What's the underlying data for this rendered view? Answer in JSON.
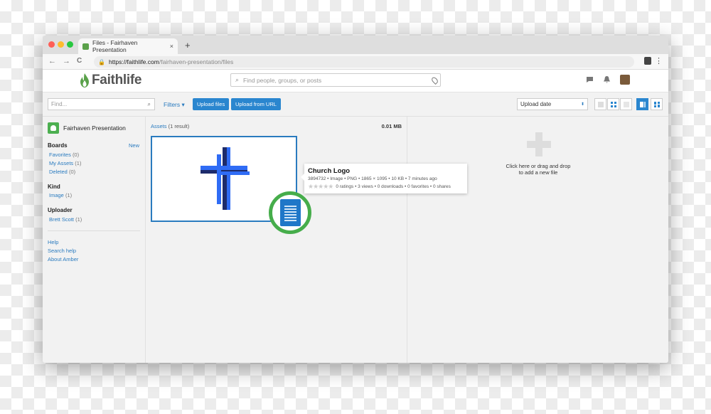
{
  "browser": {
    "tab_title": "Files - Fairhaven Presentation",
    "tab_close": "×",
    "new_tab": "+",
    "url_host": "https://faithlife.com",
    "url_path": "/fairhaven-presentation/files",
    "back": "←",
    "forward": "→",
    "reload": "C",
    "menu": "⋮",
    "dot_colors": [
      "#fe5f57",
      "#febc2e",
      "#28c840"
    ]
  },
  "header": {
    "logo_text": "Faithlife",
    "search_placeholder": "Find people, groups, or posts",
    "search_icon": "🔍",
    "chat_icon": "💬",
    "bell_icon": "🔔",
    "brand_color": "#5aa14a"
  },
  "toolbar": {
    "find_placeholder": "Find...",
    "filters_label": "Filters ▾",
    "upload_files_label": "Upload files",
    "upload_url_label": "Upload from URL",
    "sort_value": "Upload date",
    "sort_caret": "⬍",
    "accent": "#2a86cf"
  },
  "sidebar": {
    "group_name": "Fairhaven Presentation",
    "boards_heading": "Boards",
    "new_label": "New",
    "boards": [
      {
        "label": "Favorites",
        "count": "(0)"
      },
      {
        "label": "My Assets",
        "count": "(1)"
      },
      {
        "label": "Deleted",
        "count": "(0)"
      }
    ],
    "kind_heading": "Kind",
    "kinds": [
      {
        "label": "Image",
        "count": "(1)"
      }
    ],
    "uploader_heading": "Uploader",
    "uploaders": [
      {
        "label": "Brett Scott",
        "count": "(1)"
      }
    ],
    "links": [
      "Help",
      "Search help",
      "About Amber"
    ]
  },
  "assets": {
    "assets_label": "Assets",
    "result_count": "(1 result)",
    "total_size": "0.01 MB"
  },
  "tooltip": {
    "title": "Church Logo",
    "meta": "3894732  •  Image  •  PNG  •  1865 × 1095  •  10 KB  •  7 minutes ago",
    "stars": "★★★★★",
    "stats": "0 ratings • 3 views • 0 downloads • 0 favorites • 0 shares"
  },
  "upload_panel": {
    "line1": "Click here or drag and drop",
    "line2": "to add a new file"
  }
}
